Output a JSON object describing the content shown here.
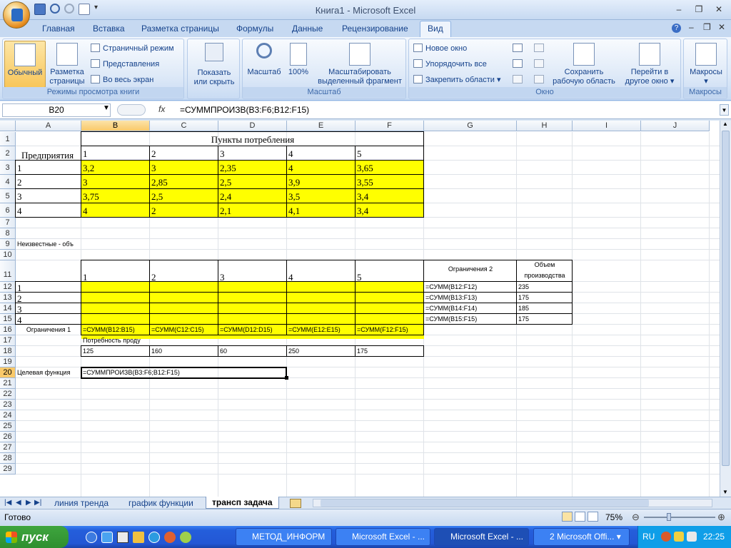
{
  "window": {
    "title": "Книга1 - Microsoft Excel"
  },
  "tabs": [
    "Главная",
    "Вставка",
    "Разметка страницы",
    "Формулы",
    "Данные",
    "Рецензирование",
    "Вид"
  ],
  "active_tab": "Вид",
  "ribbon": {
    "g1": {
      "label": "Режимы просмотра книги",
      "normal": "Обычный",
      "page_layout_1": "Разметка",
      "page_layout_2": "страницы",
      "page_mode": "Страничный режим",
      "views": "Представления",
      "fullscreen": "Во весь экран"
    },
    "g2": {
      "show_1": "Показать",
      "show_2": "или скрыть"
    },
    "g3": {
      "label": "Масштаб",
      "zoom": "Масштаб",
      "zoom100": "100%",
      "zoom_sel_1": "Масштабировать",
      "zoom_sel_2": "выделенный фрагмент"
    },
    "g4": {
      "label": "Окно",
      "new_window": "Новое окно",
      "arrange": "Упорядочить все",
      "freeze": "Закрепить области",
      "save_ws_1": "Сохранить",
      "save_ws_2": "рабочую область",
      "switch_1": "Перейти в",
      "switch_2": "другое окно"
    },
    "g5": {
      "label": "Макросы",
      "macros": "Макросы"
    }
  },
  "formula_bar": {
    "name_box": "B20",
    "fx": "fx",
    "formula": "=СУММПРОИЗВ(B3:F6;B12:F15)"
  },
  "columns": [
    "A",
    "B",
    "C",
    "D",
    "E",
    "F",
    "G",
    "H",
    "I",
    "J"
  ],
  "rows": [
    "1",
    "2",
    "3",
    "4",
    "5",
    "6",
    "7",
    "8",
    "9",
    "10",
    "11",
    "12",
    "13",
    "14",
    "15",
    "16",
    "17",
    "18",
    "19",
    "20",
    "21",
    "22",
    "23",
    "24",
    "25",
    "26",
    "27",
    "28",
    "29"
  ],
  "cells": {
    "B1": "Пункты потребления",
    "A2": "Предприятия",
    "B2": "1",
    "C2": "2",
    "D2": "3",
    "E2": "4",
    "F2": "5",
    "A3": "1",
    "B3": "3,2",
    "C3": "3",
    "D3": "2,35",
    "E3": "4",
    "F3": "3,65",
    "A4": "2",
    "B4": "3",
    "C4": "2,85",
    "D4": "2,5",
    "E4": "3,9",
    "F4": "3,55",
    "A5": "3",
    "B5": "3,75",
    "C5": "2,5",
    "D5": "2,4",
    "E5": "3,5",
    "F5": "3,4",
    "A6": "4",
    "B6": "4",
    "C6": "2",
    "D6": "2,1",
    "E6": "4,1",
    "F6": "3,4",
    "A9": "Неизвестные - объ",
    "B11": "1",
    "C11": "2",
    "D11": "3",
    "E11": "4",
    "F11": "5",
    "G11": "Ограничения 2",
    "H11a": "Объем",
    "H11b": "производства",
    "A12": "1",
    "G12": "=СУММ(B12:F12)",
    "H12": "235",
    "A13": "2",
    "G13": "=СУММ(B13:F13)",
    "H13": "175",
    "A14": "3",
    "G14": "=СУММ(B14:F14)",
    "H14": "185",
    "A15": "4",
    "G15": "=СУММ(B15:F15)",
    "H15": "175",
    "A16": "Ограничения 1",
    "B16": "=СУММ(B12:B15)",
    "C16": "=СУММ(C12:C15)",
    "D16": "=СУММ(D12:D15)",
    "E16": "=СУММ(E12:E15)",
    "F16": "=СУММ(F12:F15)",
    "B17": "Потребность проду",
    "B18": "125",
    "C18": "160",
    "D18": "60",
    "E18": "250",
    "F18": "175",
    "A20": "Целевая функция",
    "B20": "=СУММПРОИЗВ(B3:F6;B12:F15)"
  },
  "sheets": [
    "линия тренда",
    "график функции",
    "трансп задача"
  ],
  "active_sheet": "трансп задача",
  "status": {
    "ready": "Готово",
    "zoom": "75%"
  },
  "taskbar": {
    "start": "пуск",
    "buttons": [
      "МЕТОД_ИНФОРМ",
      "Microsoft Excel - ...",
      "Microsoft Excel - ...",
      "2 Microsoft Offi..."
    ],
    "lang": "RU",
    "clock": "22:25"
  },
  "colors": {
    "highlight": "#ffff00",
    "ribbon": "#dde9f8",
    "taskbar": "#245edb"
  }
}
